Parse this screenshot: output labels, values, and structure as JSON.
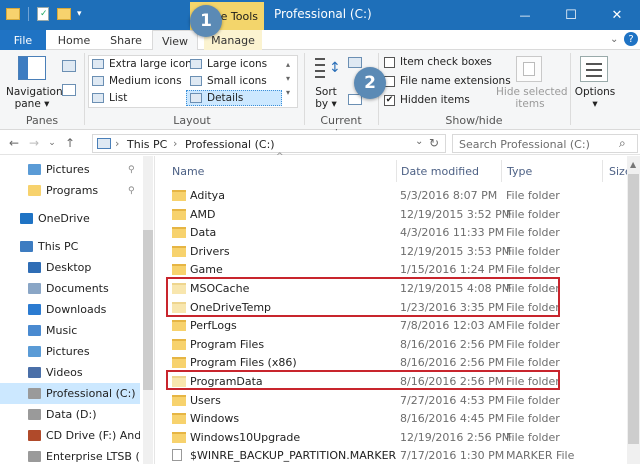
{
  "window": {
    "title": "Professional (C:)",
    "context_tab": "Drive Tools",
    "minimize": "—",
    "maximize": "☐",
    "close": "✕"
  },
  "ribbon_tabs": [
    {
      "label": "File"
    },
    {
      "label": "Home"
    },
    {
      "label": "Share"
    },
    {
      "label": "View"
    },
    {
      "label": "Manage"
    }
  ],
  "ribbon": {
    "panes": {
      "navigation_pane_line1": "Navigation",
      "navigation_pane_line2": "pane ▾",
      "label": "Panes"
    },
    "layout": {
      "options": [
        "Extra large icons",
        "Large icons",
        "Medium icons",
        "Small icons",
        "List",
        "Details"
      ],
      "selected": "Details",
      "label": "Layout"
    },
    "current_view": {
      "sort_by_line1": "Sort",
      "sort_by_line2": "by ▾",
      "label": "Current view"
    },
    "show_hide": {
      "item_check_boxes": "Item check boxes",
      "file_name_extensions": "File name extensions",
      "hidden_items": "Hidden items",
      "hide_selected_line1": "Hide selected",
      "hide_selected_line2": "items",
      "label": "Show/hide",
      "item_check_boxes_checked": false,
      "file_name_extensions_checked": false,
      "hidden_items_checked": true
    },
    "options": {
      "label": "Options",
      "arrow": "▾"
    }
  },
  "annotations": {
    "badge1": "1",
    "badge2": "2"
  },
  "address": {
    "crumbs": [
      "This PC",
      "Professional (C:)"
    ],
    "separator": "›",
    "search_placeholder": "Search Professional (C:)"
  },
  "nav_pane": [
    {
      "label": "Pictures",
      "icon": "pictures-icon",
      "pinned": true
    },
    {
      "label": "Programs",
      "icon": "folder-icon",
      "pinned": true
    },
    {
      "label": "OneDrive",
      "icon": "onedrive-icon"
    },
    {
      "label": "This PC",
      "icon": "computer-icon"
    },
    {
      "label": "Desktop",
      "icon": "desktop-icon"
    },
    {
      "label": "Documents",
      "icon": "documents-icon"
    },
    {
      "label": "Downloads",
      "icon": "downloads-icon"
    },
    {
      "label": "Music",
      "icon": "music-icon"
    },
    {
      "label": "Pictures",
      "icon": "pictures-icon"
    },
    {
      "label": "Videos",
      "icon": "videos-icon"
    },
    {
      "label": "Professional (C:)",
      "icon": "drive-icon",
      "selected": true
    },
    {
      "label": "Data (D:)",
      "icon": "drive-icon"
    },
    {
      "label": "CD Drive (F:) Android",
      "icon": "cd-drive-icon"
    },
    {
      "label": "Enterprise LTSB (G:)",
      "icon": "drive-icon"
    }
  ],
  "file_list": {
    "columns": [
      "Name",
      "Date modified",
      "Type",
      "Size"
    ],
    "rows": [
      {
        "name": "Aditya",
        "date": "5/3/2016 8:07 PM",
        "type": "File folder"
      },
      {
        "name": "AMD",
        "date": "12/19/2015 3:52 PM",
        "type": "File folder"
      },
      {
        "name": "Data",
        "date": "4/3/2016 11:33 PM",
        "type": "File folder"
      },
      {
        "name": "Drivers",
        "date": "12/19/2015 3:53 PM",
        "type": "File folder"
      },
      {
        "name": "Game",
        "date": "1/15/2016 1:24 PM",
        "type": "File folder"
      },
      {
        "name": "MSOCache",
        "date": "12/19/2015 4:08 PM",
        "type": "File folder",
        "hidden": true
      },
      {
        "name": "OneDriveTemp",
        "date": "1/23/2016 3:35 PM",
        "type": "File folder",
        "hidden": true
      },
      {
        "name": "PerfLogs",
        "date": "7/8/2016 12:03 AM",
        "type": "File folder"
      },
      {
        "name": "Program Files",
        "date": "8/16/2016 2:56 PM",
        "type": "File folder"
      },
      {
        "name": "Program Files (x86)",
        "date": "8/16/2016 2:56 PM",
        "type": "File folder"
      },
      {
        "name": "ProgramData",
        "date": "8/16/2016 2:56 PM",
        "type": "File folder",
        "hidden": true
      },
      {
        "name": "Users",
        "date": "7/27/2016 4:53 PM",
        "type": "File folder"
      },
      {
        "name": "Windows",
        "date": "8/16/2016 4:45 PM",
        "type": "File folder"
      },
      {
        "name": "Windows10Upgrade",
        "date": "12/19/2016 2:56 PM",
        "type": "File folder"
      },
      {
        "name": "$WINRE_BACKUP_PARTITION.MARKER",
        "date": "7/17/2016 1:30 PM",
        "type": "MARKER File",
        "file": true
      }
    ]
  }
}
